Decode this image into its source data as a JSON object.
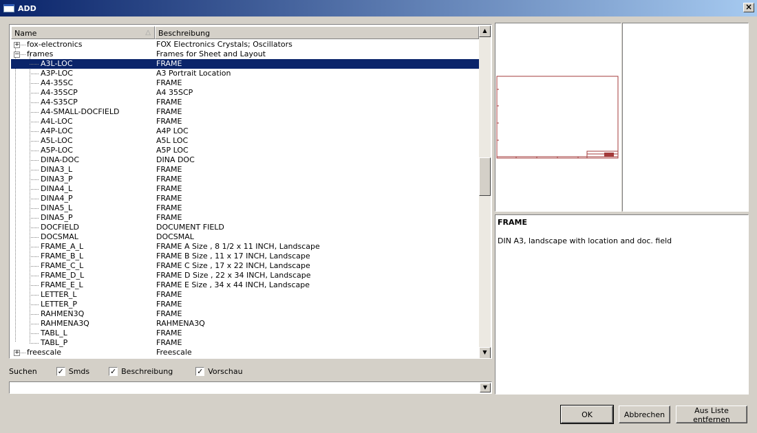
{
  "window": {
    "title": "ADD"
  },
  "columns": {
    "name": "Name",
    "description": "Beschreibung"
  },
  "tree": {
    "rows": [
      {
        "name": "fox-electronics",
        "desc": "FOX Electronics Crystals; Oscillators",
        "level": 0,
        "expander": "+"
      },
      {
        "name": "frames",
        "desc": "Frames for Sheet and Layout",
        "level": 0,
        "expander": "−"
      },
      {
        "name": "A3L-LOC",
        "desc": "FRAME",
        "level": 1,
        "selected": true
      },
      {
        "name": "A3P-LOC",
        "desc": "A3 Portrait Location",
        "level": 1
      },
      {
        "name": "A4-35SC",
        "desc": "FRAME",
        "level": 1
      },
      {
        "name": "A4-35SCP",
        "desc": "A4 35SCP",
        "level": 1
      },
      {
        "name": "A4-S35CP",
        "desc": "FRAME",
        "level": 1
      },
      {
        "name": "A4-SMALL-DOCFIELD",
        "desc": "FRAME",
        "level": 1
      },
      {
        "name": "A4L-LOC",
        "desc": "FRAME",
        "level": 1
      },
      {
        "name": "A4P-LOC",
        "desc": "A4P LOC",
        "level": 1
      },
      {
        "name": "A5L-LOC",
        "desc": "A5L LOC",
        "level": 1
      },
      {
        "name": "A5P-LOC",
        "desc": "A5P LOC",
        "level": 1
      },
      {
        "name": "DINA-DOC",
        "desc": "DINA DOC",
        "level": 1
      },
      {
        "name": "DINA3_L",
        "desc": "FRAME",
        "level": 1
      },
      {
        "name": "DINA3_P",
        "desc": "FRAME",
        "level": 1
      },
      {
        "name": "DINA4_L",
        "desc": "FRAME",
        "level": 1
      },
      {
        "name": "DINA4_P",
        "desc": "FRAME",
        "level": 1
      },
      {
        "name": "DINA5_L",
        "desc": "FRAME",
        "level": 1
      },
      {
        "name": "DINA5_P",
        "desc": "FRAME",
        "level": 1
      },
      {
        "name": "DOCFIELD",
        "desc": "DOCUMENT FIELD",
        "level": 1
      },
      {
        "name": "DOCSMAL",
        "desc": "DOCSMAL",
        "level": 1
      },
      {
        "name": "FRAME_A_L",
        "desc": "FRAME A Size , 8 1/2 x 11 INCH, Landscape",
        "level": 1
      },
      {
        "name": "FRAME_B_L",
        "desc": "FRAME B Size , 11 x 17 INCH, Landscape",
        "level": 1
      },
      {
        "name": "FRAME_C_L",
        "desc": "FRAME C Size , 17 x 22 INCH, Landscape",
        "level": 1
      },
      {
        "name": "FRAME_D_L",
        "desc": "FRAME D Size , 22 x 34 INCH, Landscape",
        "level": 1
      },
      {
        "name": "FRAME_E_L",
        "desc": "FRAME E Size , 34 x 44 INCH, Landscape",
        "level": 1
      },
      {
        "name": "LETTER_L",
        "desc": "FRAME",
        "level": 1
      },
      {
        "name": "LETTER_P",
        "desc": "FRAME",
        "level": 1
      },
      {
        "name": "RAHMEN3Q",
        "desc": "FRAME",
        "level": 1
      },
      {
        "name": "RAHMENA3Q",
        "desc": "RAHMENA3Q",
        "level": 1
      },
      {
        "name": "TABL_L",
        "desc": "FRAME",
        "level": 1
      },
      {
        "name": "TABL_P",
        "desc": "FRAME",
        "level": 1
      },
      {
        "name": "freescale",
        "desc": "Freescale",
        "level": 0,
        "expander": "+"
      }
    ]
  },
  "search": {
    "label": "Suchen",
    "smds_label": "Smds",
    "smds_checked": true,
    "desc_label": "Beschreibung",
    "desc_checked": true,
    "preview_label": "Vorschau",
    "preview_checked": true,
    "value": ""
  },
  "detail": {
    "title": "FRAME",
    "text": "DIN A3, landscape with location and doc. field"
  },
  "buttons": {
    "ok": "OK",
    "cancel": "Abbrechen",
    "remove": "Aus Liste entfernen"
  },
  "colors": {
    "frame_preview": "#a33a3a",
    "selection": "#0a246a",
    "title_gradient_start": "#0a246a"
  },
  "glyphs": {
    "sort": "△",
    "up": "▲",
    "down": "▼",
    "close": "×",
    "check": "✓"
  }
}
